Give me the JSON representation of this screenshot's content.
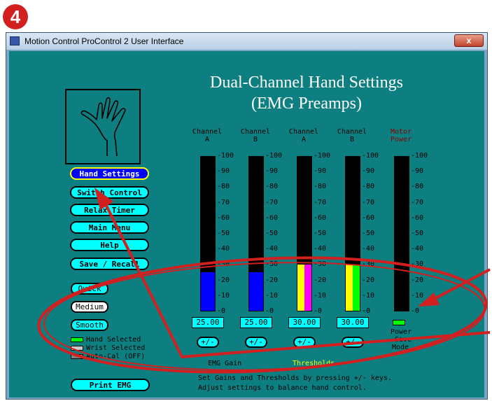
{
  "step_number": "4",
  "window": {
    "title": "Motion Control ProControl 2 User Interface",
    "close_label": "x",
    "page_title_line1": "Dual-Channel Hand Settings",
    "page_title_line2": "(EMG Preamps)"
  },
  "nav": [
    {
      "label": "Hand Settings",
      "active": true
    },
    {
      "label": "Switch Control",
      "active": false
    },
    {
      "label": "Relax Timer",
      "active": false
    },
    {
      "label": "Main Menu",
      "active": false
    },
    {
      "label": "Help",
      "active": false
    },
    {
      "label": "Save / Recall",
      "active": false
    }
  ],
  "speed_modes": [
    {
      "label": "Quick",
      "active": false
    },
    {
      "label": "Medium",
      "active": true
    },
    {
      "label": "Smooth",
      "active": false
    }
  ],
  "legend": [
    {
      "label": "Hand Selected",
      "color": "#00ff00"
    },
    {
      "label": "Wrist Selected",
      "color": "#c8c8c8"
    },
    {
      "label": "Auto-Cal (OFF)",
      "color": "#808080"
    }
  ],
  "print_button": "Print EMG",
  "meters": [
    {
      "label_line1": "Channel",
      "label_line2": "A",
      "value": "25.00",
      "level": 25,
      "fill_color": "#0000ff",
      "button": "+/-"
    },
    {
      "label_line1": "Channel",
      "label_line2": "B",
      "value": "25.00",
      "level": 25,
      "fill_color": "#0000ff",
      "button": "+/-"
    },
    {
      "label_line1": "Channel",
      "label_line2": "A",
      "value": "30.00",
      "level": 30,
      "fill_color": "#ff00ff",
      "button": "+/-"
    },
    {
      "label_line1": "Channel",
      "label_line2": "B",
      "value": "30.00",
      "level": 30,
      "fill_color": "#00ff00",
      "button": "+/-"
    },
    {
      "label_line1": "Motor",
      "label_line2": "Power",
      "value": "",
      "level": 0,
      "fill_color": "#000000",
      "button": ""
    }
  ],
  "scale_ticks": [
    "100",
    "90",
    "80",
    "70",
    "60",
    "50",
    "40",
    "30",
    "20",
    "10",
    "0"
  ],
  "power_save_lines": [
    "Power",
    "Save",
    "Mode"
  ],
  "emg_gain_label": "EMG Gain",
  "threshold_label": "Thresholds",
  "instruction_line1": "Set Gains and Thresholds by pressing +/- keys.",
  "instruction_line2": "Adjust settings to balance hand control.",
  "colors": {
    "client_bg": "#0e7f80",
    "annotation": "#d21f1f",
    "button_bg": "#00ffff",
    "gain_fill": "#0000ff",
    "threshold_label_color": "#ffff00",
    "motor_label_color": "#8b0000"
  }
}
